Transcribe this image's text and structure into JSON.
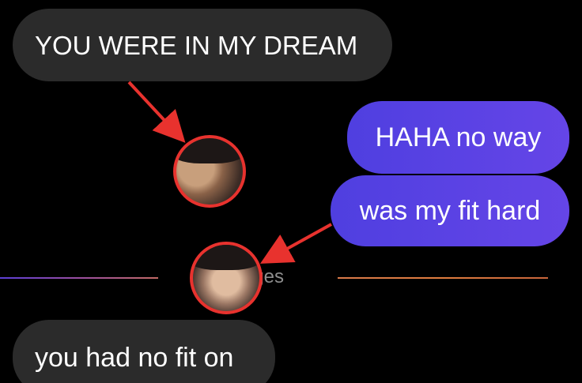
{
  "conversation": {
    "messages": [
      {
        "side": "received",
        "text": "YOU WERE IN MY DREAM"
      },
      {
        "side": "sent",
        "text": "HAHA no way"
      },
      {
        "side": "sent",
        "text": "was my fit hard"
      },
      {
        "side": "received",
        "text": "you had no fit on"
      }
    ],
    "divider_label": "N           ssages"
  },
  "colors": {
    "received_bubble": "#2b2b2b",
    "sent_bubble_start": "#4f3fe0",
    "sent_bubble_end": "#6545e7",
    "annotation_red": "#e8322e",
    "background": "#000000"
  },
  "icons": {
    "reaction_avatar_1": "face-photo-avatar",
    "reaction_avatar_2": "face-photo-avatar",
    "annotation_arrows": "red-arrow"
  }
}
